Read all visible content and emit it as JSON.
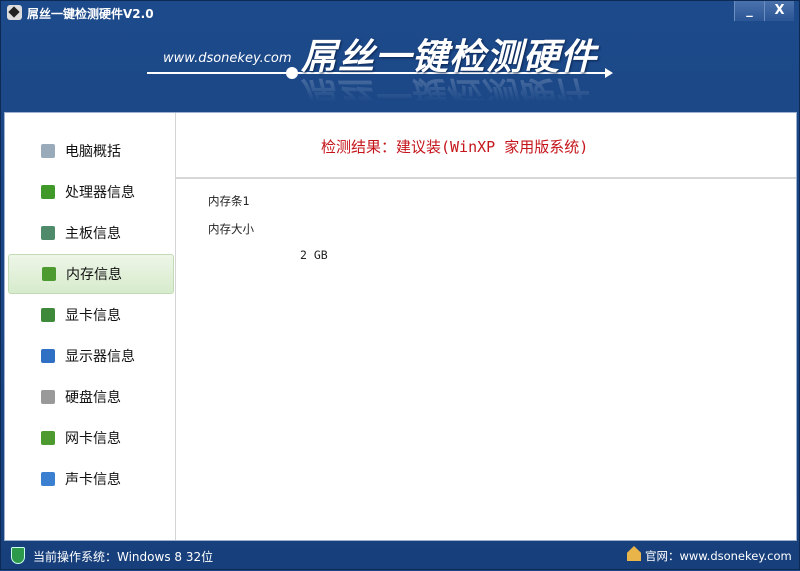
{
  "window": {
    "title": "屌丝一键检测硬件V2.0",
    "minimize": "_",
    "close": "X"
  },
  "banner": {
    "url": "www.dsonekey.com",
    "title": "屌丝一键检测硬件"
  },
  "sidebar": {
    "items": [
      {
        "label": "电脑概括",
        "icon": "computer-icon",
        "color": "#9ab"
      },
      {
        "label": "处理器信息",
        "icon": "cpu-icon",
        "color": "#3f9a2a"
      },
      {
        "label": "主板信息",
        "icon": "motherboard-icon",
        "color": "#4f8a6a"
      },
      {
        "label": "内存信息",
        "icon": "memory-icon",
        "color": "#4c9a30",
        "selected": true
      },
      {
        "label": "显卡信息",
        "icon": "graphics-card-icon",
        "color": "#3e8a3a"
      },
      {
        "label": "显示器信息",
        "icon": "monitor-icon",
        "color": "#2f6fc4"
      },
      {
        "label": "硬盘信息",
        "icon": "hard-disk-icon",
        "color": "#999"
      },
      {
        "label": "网卡信息",
        "icon": "network-card-icon",
        "color": "#4c9a30"
      },
      {
        "label": "声卡信息",
        "icon": "speaker-icon",
        "color": "#3a7fd0"
      }
    ]
  },
  "main": {
    "result": "检测结果：建议装(WinXP 家用版系统)",
    "memory_slot": "内存条1",
    "size_label": "内存大小",
    "size_value": "2 GB"
  },
  "status": {
    "os": "当前操作系统：Windows 8 32位",
    "site": "官网：www.dsonekey.com"
  }
}
